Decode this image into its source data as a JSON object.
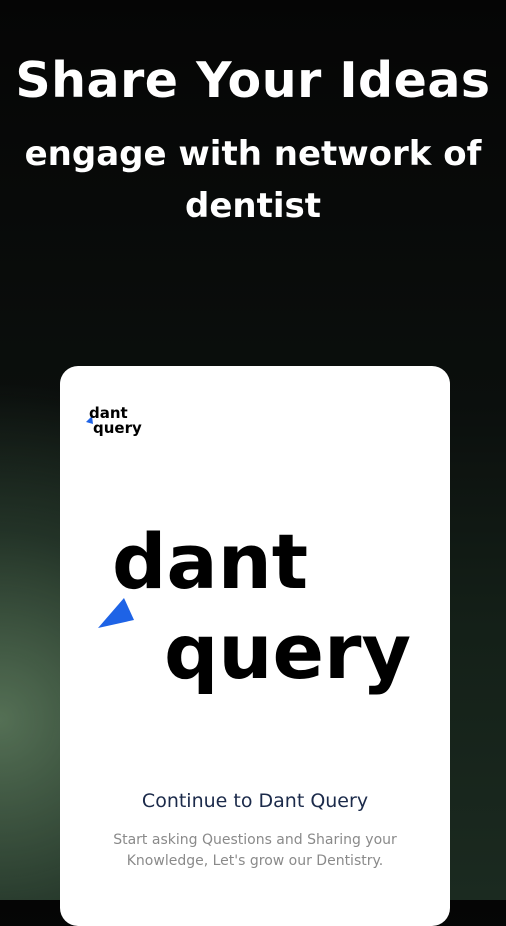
{
  "header": {
    "title": "Share Your Ideas",
    "subtitle_line1": "engage with network of",
    "subtitle_line2": "dentist"
  },
  "card": {
    "brand": {
      "line1": "dant",
      "line2": "query"
    },
    "cta_text": "Continue to Dant Query",
    "description_line1": "Start asking Questions and Sharing your",
    "description_line2": "Knowledge, Let's grow our Dentistry."
  },
  "colors": {
    "accent_blue": "#1e63e6",
    "cta_text": "#1b2a4a",
    "desc_text": "#8a8a8a"
  },
  "icons": [
    "dant-query-logo-small",
    "dant-query-logo-large"
  ]
}
